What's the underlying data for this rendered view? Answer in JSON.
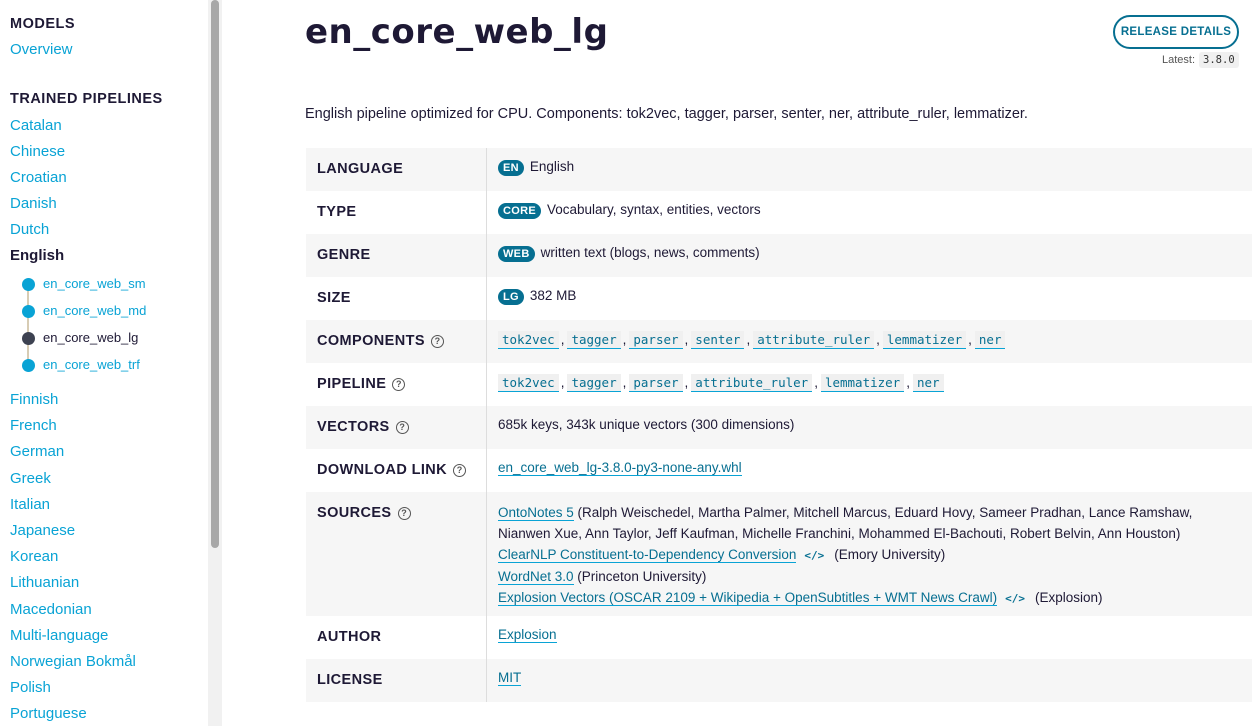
{
  "sidebar": {
    "section_models": "MODELS",
    "overview": "Overview",
    "section_pipelines": "TRAINED PIPELINES",
    "languages_before": [
      "Catalan",
      "Chinese",
      "Croatian",
      "Danish",
      "Dutch"
    ],
    "current_language": "English",
    "english_models": [
      "en_core_web_sm",
      "en_core_web_md",
      "en_core_web_lg",
      "en_core_web_trf"
    ],
    "current_model": "en_core_web_lg",
    "languages_after": [
      "Finnish",
      "French",
      "German",
      "Greek",
      "Italian",
      "Japanese",
      "Korean",
      "Lithuanian",
      "Macedonian",
      "Multi-language",
      "Norwegian Bokmål",
      "Polish",
      "Portuguese"
    ]
  },
  "page": {
    "title": "en_core_web_lg",
    "release_button": "RELEASE DETAILS",
    "latest_label": "Latest:",
    "latest_version": "3.8.0",
    "description": "English pipeline optimized for CPU. Components: tok2vec, tagger, parser, senter, ner, attribute_ruler, lemmatizer."
  },
  "info": {
    "language": {
      "key": "LANGUAGE",
      "tag": "EN",
      "value": "English"
    },
    "type": {
      "key": "TYPE",
      "tag": "CORE",
      "value": "Vocabulary, syntax, entities, vectors"
    },
    "genre": {
      "key": "GENRE",
      "tag": "WEB",
      "value": "written text (blogs, news, comments)"
    },
    "size": {
      "key": "SIZE",
      "tag": "LG",
      "value": "382 MB"
    },
    "components": {
      "key": "COMPONENTS",
      "items": [
        "tok2vec",
        "tagger",
        "parser",
        "senter",
        "attribute_ruler",
        "lemmatizer",
        "ner"
      ]
    },
    "pipeline": {
      "key": "PIPELINE",
      "items": [
        "tok2vec",
        "tagger",
        "parser",
        "attribute_ruler",
        "lemmatizer",
        "ner"
      ]
    },
    "vectors": {
      "key": "VECTORS",
      "value": "685k keys, 343k unique vectors (300 dimensions)"
    },
    "download": {
      "key": "DOWNLOAD LINK",
      "value": "en_core_web_lg-3.8.0-py3-none-any.whl"
    },
    "sources": {
      "key": "SOURCES",
      "ontonotes_link": "OntoNotes 5",
      "ontonotes_rest": " (Ralph Weischedel, Martha Palmer, Mitchell Marcus, Eduard Hovy, Sameer Pradhan, Lance Ramshaw, Nianwen Xue, Ann Taylor, Jeff Kaufman, Michelle Franchini, Mohammed El-Bachouti, Robert Belvin, Ann Houston)",
      "clearnlp_link": "ClearNLP Constituent-to-Dependency Conversion",
      "clearnlp_rest": "(Emory University)",
      "wordnet_link": "WordNet 3.0",
      "wordnet_rest": " (Princeton University)",
      "vectors_link": "Explosion Vectors (OSCAR 2109 + Wikipedia + OpenSubtitles + WMT News Crawl)",
      "vectors_rest": "(Explosion)",
      "code_icon": "</>"
    },
    "author": {
      "key": "AUTHOR",
      "value": "Explosion"
    },
    "license": {
      "key": "LICENSE",
      "value": "MIT"
    }
  },
  "help_icon": "?",
  "colors": {
    "accent": "#066f91",
    "link": "#09a3d5",
    "text": "#1e1935"
  }
}
